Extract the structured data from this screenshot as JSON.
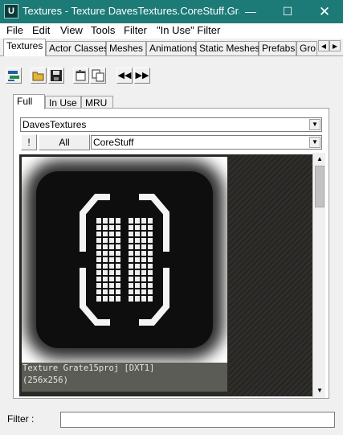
{
  "window": {
    "title": "Textures - Texture DavesTextures.CoreStuff.Grat...",
    "app_icon": "unreal-logo-icon",
    "controls": [
      "minimize",
      "maximize",
      "close"
    ],
    "accent_color": "#1c7a77"
  },
  "menu": {
    "items": [
      "File",
      "Edit",
      "View",
      "Tools",
      "Filter",
      "\"In Use\" Filter"
    ]
  },
  "browser_tabs": {
    "items": [
      "Textures",
      "Actor Classes",
      "Meshes",
      "Animations",
      "Static Meshes",
      "Prefabs",
      "Gro"
    ],
    "active": "Textures"
  },
  "toolbar": {
    "icons": [
      "dock-icon",
      "open-folder-icon",
      "save-icon",
      "properties-icon",
      "copy-icon",
      "prev-icon",
      "next-icon"
    ]
  },
  "view_tabs": {
    "items": [
      "Full",
      "In Use",
      "MRU"
    ],
    "active": "Full"
  },
  "package_combo": {
    "value": "DavesTextures"
  },
  "group_controls": {
    "exclaim_label": "!",
    "all_label": "All",
    "group_value": "CoreStuff"
  },
  "selected_texture": {
    "caption_line1": "Texture Grate15proj  [DXT1]",
    "caption_line2": "(256x256)"
  },
  "filter": {
    "label": "Filter :",
    "value": ""
  }
}
